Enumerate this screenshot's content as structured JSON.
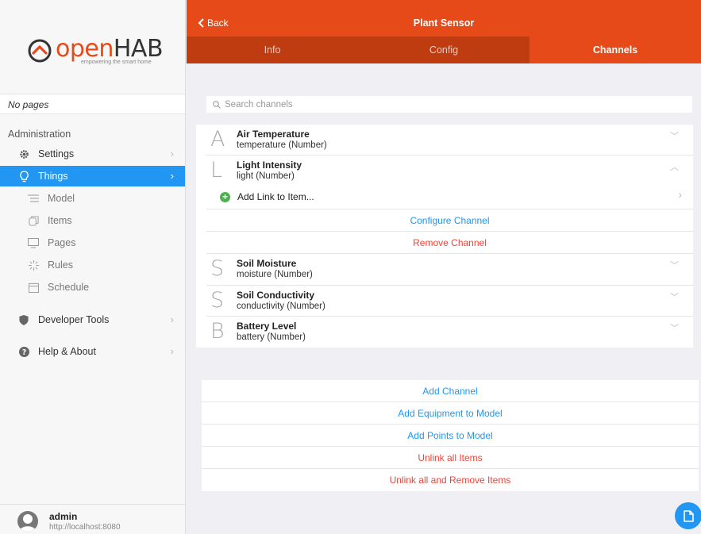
{
  "sidebar": {
    "logo_open": "open",
    "logo_hab": "HAB",
    "logo_tagline": "empowering the smart home",
    "no_pages": "No pages",
    "admin_heading": "Administration",
    "items": [
      {
        "label": "Settings",
        "icon": "gear-icon"
      },
      {
        "label": "Things",
        "icon": "lightbulb-icon"
      },
      {
        "label": "Model",
        "icon": "list-icon"
      },
      {
        "label": "Items",
        "icon": "items-icon"
      },
      {
        "label": "Pages",
        "icon": "monitor-icon"
      },
      {
        "label": "Rules",
        "icon": "sparkle-icon"
      },
      {
        "label": "Schedule",
        "icon": "calendar-icon"
      },
      {
        "label": "Developer Tools",
        "icon": "shield-icon"
      },
      {
        "label": "Help & About",
        "icon": "help-icon"
      }
    ],
    "user": {
      "name": "admin",
      "url": "http://localhost:8080"
    }
  },
  "header": {
    "back_label": "Back",
    "title": "Plant Sensor",
    "tabs": [
      "Info",
      "Config",
      "Channels"
    ]
  },
  "search": {
    "placeholder": "Search channels"
  },
  "channels": [
    {
      "letter": "A",
      "name": "Air Temperature",
      "sub": "temperature (Number)"
    },
    {
      "letter": "L",
      "name": "Light Intensity",
      "sub": "light (Number)"
    },
    {
      "letter": "S",
      "name": "Soil Moisture",
      "sub": "moisture (Number)"
    },
    {
      "letter": "S",
      "name": "Soil Conductivity",
      "sub": "conductivity (Number)"
    },
    {
      "letter": "B",
      "name": "Battery Level",
      "sub": "battery (Number)"
    }
  ],
  "expanded": {
    "add_link": "Add Link to Item...",
    "configure": "Configure Channel",
    "remove": "Remove Channel"
  },
  "actions": {
    "add_channel": "Add Channel",
    "add_equipment": "Add Equipment to Model",
    "add_points": "Add Points to Model",
    "unlink_all": "Unlink all Items",
    "unlink_remove": "Unlink all and Remove Items"
  },
  "colors": {
    "accent": "#e64a19",
    "active": "#2196f3",
    "danger": "#f44336",
    "add": "#4caf50"
  }
}
